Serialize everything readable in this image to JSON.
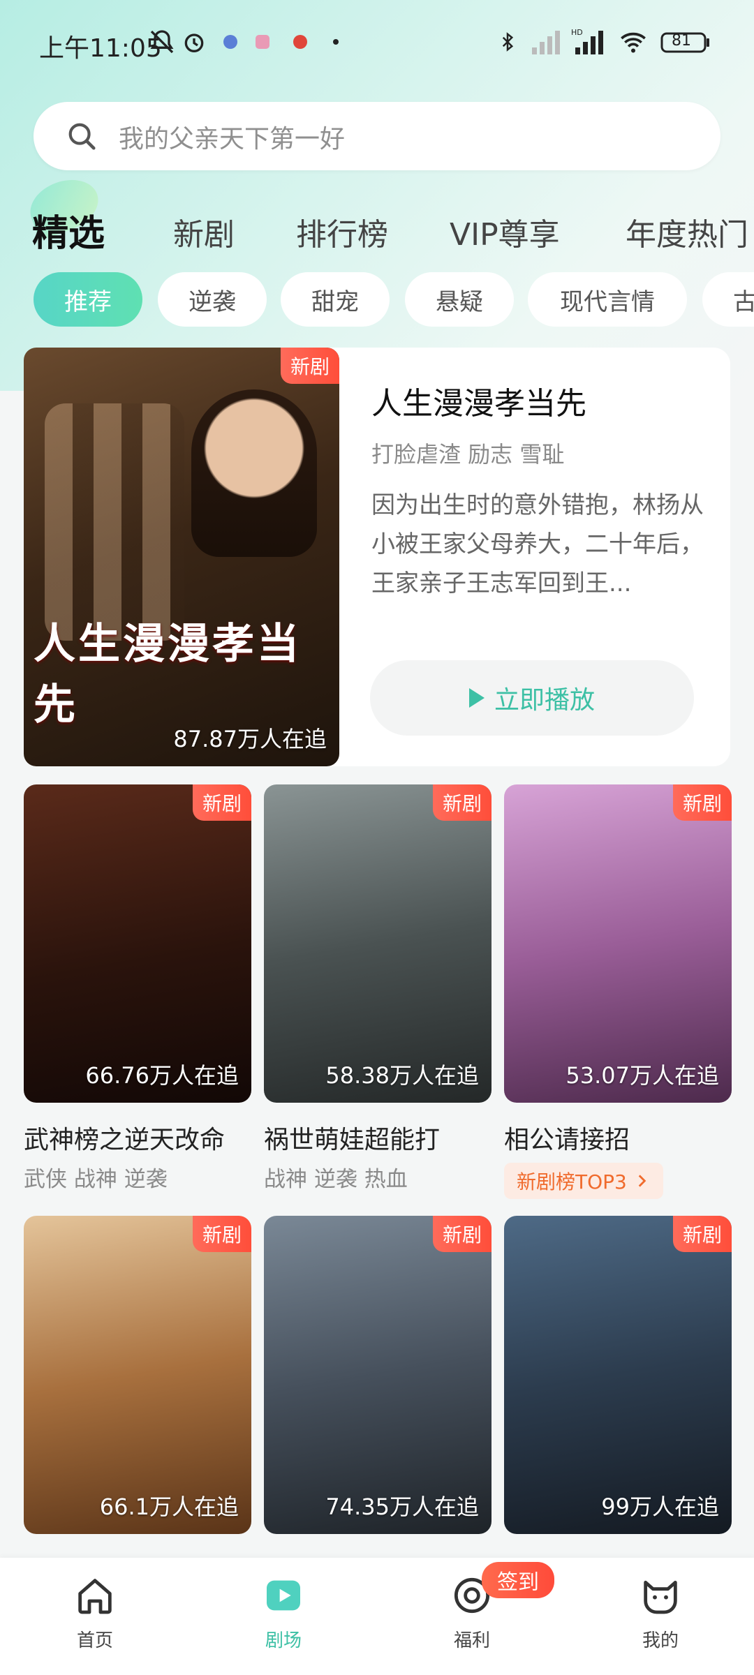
{
  "status": {
    "time": "上午11:05",
    "battery": "81"
  },
  "search": {
    "placeholder": "我的父亲天下第一好"
  },
  "tabs": [
    "精选",
    "新剧",
    "排行榜",
    "VIP尊享",
    "年度热门"
  ],
  "chips": [
    "推荐",
    "逆袭",
    "甜宠",
    "悬疑",
    "现代言情",
    "古"
  ],
  "featured": {
    "badge": "新剧",
    "poster_title": "人生漫漫孝当先",
    "followers": "87.87万人在追",
    "title": "人生漫漫孝当先",
    "tags": "打脸虐渣 励志 雪耻",
    "description": "因为出生时的意外错抱，林扬从小被王家父母养大，二十年后，王家亲子王志军回到王...",
    "play_label": "立即播放"
  },
  "grid": [
    {
      "badge": "新剧",
      "followers": "66.76万人在追",
      "title": "武神榜之逆天改命",
      "tags": "武侠 战神 逆袭",
      "colors": [
        "#3a1c16",
        "#6d3a22"
      ]
    },
    {
      "badge": "新剧",
      "followers": "58.38万人在追",
      "title": "祸世萌娃超能打",
      "tags": "战神 逆袭 热血",
      "colors": [
        "#5e6868",
        "#2f3434"
      ]
    },
    {
      "badge": "新剧",
      "followers": "53.07万人在追",
      "title": "相公请接招",
      "rank": "新剧榜TOP3",
      "colors": [
        "#c88cc7",
        "#6d3d6d"
      ]
    },
    {
      "badge": "新剧",
      "followers": "66.1万人在追",
      "colors": [
        "#d9b58a",
        "#7a4a2a"
      ]
    },
    {
      "badge": "新剧",
      "followers": "74.35万人在追",
      "colors": [
        "#5a6a78",
        "#2a3038"
      ]
    },
    {
      "badge": "新剧",
      "followers": "99万人在追",
      "colors": [
        "#3d5670",
        "#1c2430"
      ]
    }
  ],
  "nav": {
    "home": "首页",
    "theater": "剧场",
    "welfare": "福利",
    "mine": "我的",
    "sign_in": "签到"
  }
}
